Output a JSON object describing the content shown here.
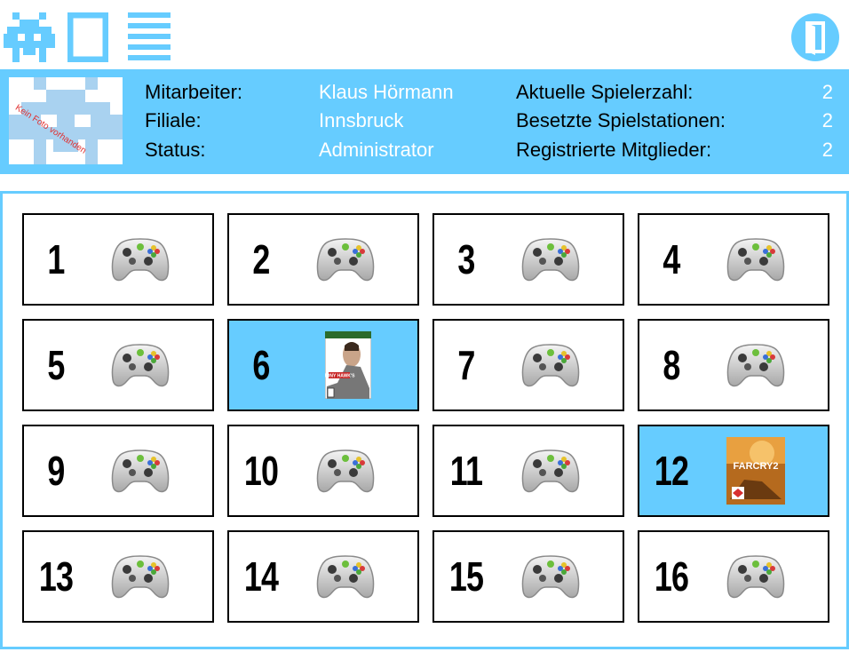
{
  "toolbar": {
    "icons": [
      "invader-icon",
      "window-icon",
      "menu-icon",
      "logout-door-icon"
    ],
    "accent": "#66ccff"
  },
  "info": {
    "photo_placeholder": "Kein Foto vorhanden",
    "employee_label": "Mitarbeiter:",
    "employee_value": "Klaus Hörmann",
    "branch_label": "Filiale:",
    "branch_value": "Innsbruck",
    "status_label": "Status:",
    "status_value": "Administrator",
    "players_label": "Aktuelle Spielerzahl:",
    "players_value": "2",
    "occupied_label": "Besetzte Spielstationen:",
    "occupied_value": "2",
    "members_label": "Registrierte Mitglieder:",
    "members_value": "2"
  },
  "stations": [
    {
      "number": "1",
      "state": "free",
      "icon": "controller-icon"
    },
    {
      "number": "2",
      "state": "free",
      "icon": "controller-icon"
    },
    {
      "number": "3",
      "state": "free",
      "icon": "controller-icon"
    },
    {
      "number": "4",
      "state": "free",
      "icon": "controller-icon"
    },
    {
      "number": "5",
      "state": "free",
      "icon": "controller-icon"
    },
    {
      "number": "6",
      "state": "occupied",
      "icon": "game-cover-tony-hawk-icon",
      "cover_text": "TONY HAWK'S"
    },
    {
      "number": "7",
      "state": "free",
      "icon": "controller-icon"
    },
    {
      "number": "8",
      "state": "free",
      "icon": "controller-icon"
    },
    {
      "number": "9",
      "state": "free",
      "icon": "controller-icon"
    },
    {
      "number": "10",
      "state": "free",
      "icon": "controller-icon"
    },
    {
      "number": "11",
      "state": "free",
      "icon": "controller-icon"
    },
    {
      "number": "12",
      "state": "occupied",
      "icon": "game-cover-far-cry-2-icon",
      "cover_text": "FARCRY2"
    },
    {
      "number": "13",
      "state": "free",
      "icon": "controller-icon"
    },
    {
      "number": "14",
      "state": "free",
      "icon": "controller-icon"
    },
    {
      "number": "15",
      "state": "free",
      "icon": "controller-icon"
    },
    {
      "number": "16",
      "state": "free",
      "icon": "controller-icon"
    }
  ],
  "colors": {
    "occupied": "#66ccff",
    "free": "#ffffff"
  }
}
